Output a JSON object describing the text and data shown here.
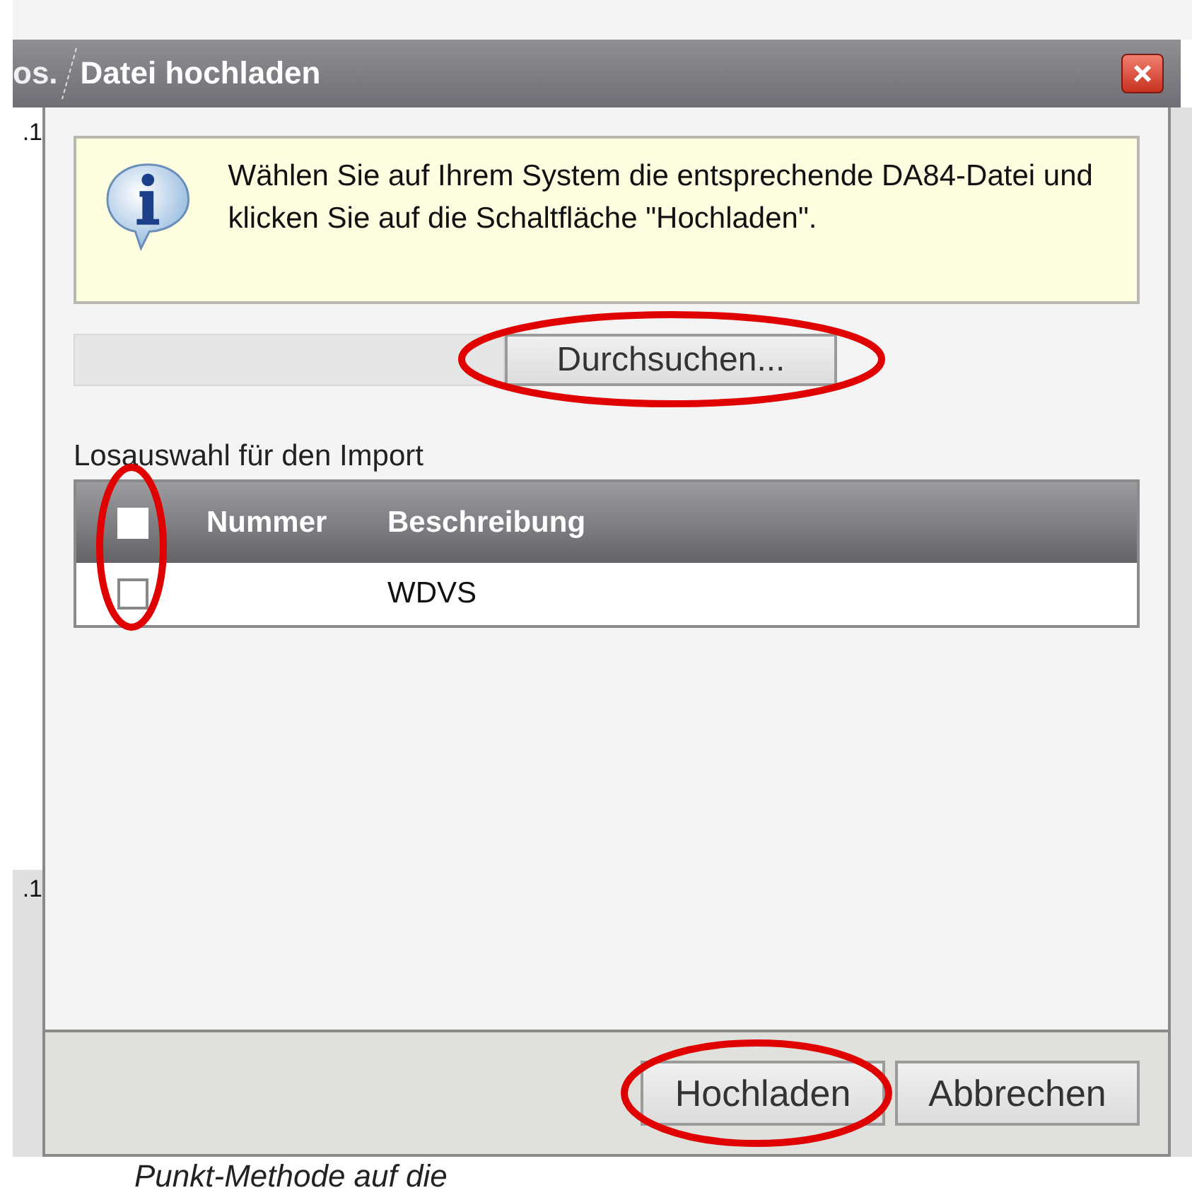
{
  "background": {
    "tab_fragment": "os.",
    "cell_texts": [
      ".1",
      ".1"
    ],
    "footer_text": "Punkt-Methode auf die"
  },
  "dialog": {
    "title": "Datei hochladen",
    "info": "Wählen Sie auf Ihrem System die entsprechende DA84-Datei und klicken Sie auf die Schaltfläche \"Hochladen\".",
    "browse_button": {
      "label": "Durchsuchen...",
      "highlighted": true
    },
    "table": {
      "caption": "Losauswahl für den Import",
      "checkbox_column_highlighted": true,
      "select_all_checked": false,
      "columns": [
        "Nummer",
        "Beschreibung"
      ],
      "rows": [
        {
          "checked": false,
          "cells": [
            "",
            "WDVS"
          ]
        }
      ]
    },
    "buttons": [
      {
        "label": "Hochladen",
        "highlighted": true
      },
      {
        "label": "Abbrechen",
        "highlighted": false
      }
    ]
  }
}
